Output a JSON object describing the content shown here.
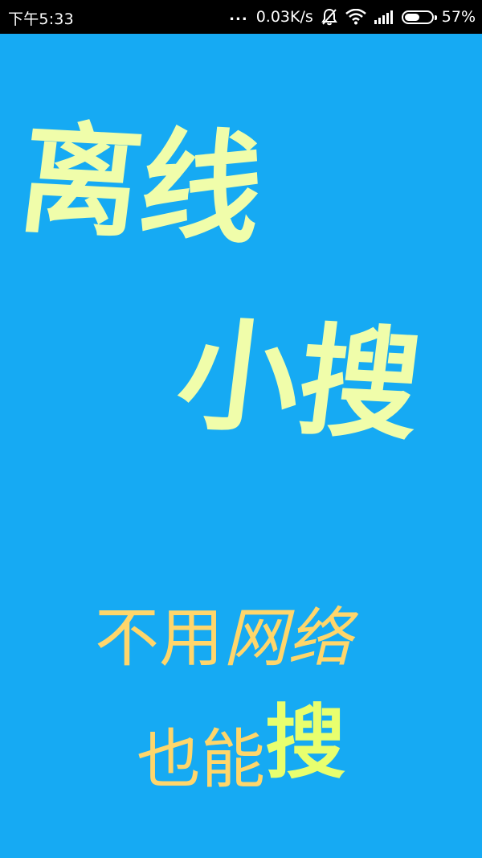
{
  "status_bar": {
    "time": "下午5:33",
    "more": "...",
    "network_speed": "0.03K/s",
    "icons": [
      "mute-bell-icon",
      "wifi-icon",
      "signal-icon",
      "battery-icon"
    ],
    "battery_percent": "57%",
    "battery_level": 0.57
  },
  "splash": {
    "title_line1": "离线",
    "title_line2": "小搜",
    "slogan_line1_normal": "不用",
    "slogan_line1_italic": "网络",
    "slogan_line2_normal": "也能",
    "slogan_line2_emphasis": "搜"
  },
  "colors": {
    "background": "#16aaf3",
    "title": "#f0fdaa",
    "slogan": "#ffd66b",
    "slogan_emphasis": "#e8ff6e"
  }
}
